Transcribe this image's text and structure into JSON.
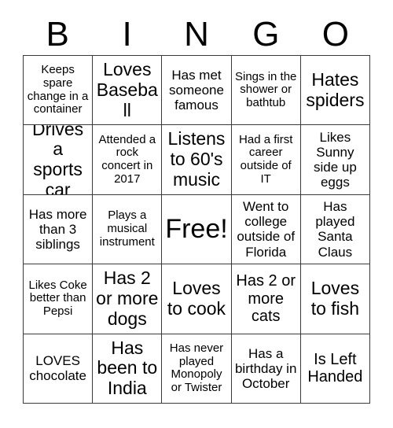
{
  "card": {
    "header_letters": [
      "B",
      "I",
      "N",
      "G",
      "O"
    ],
    "grid": {
      "columns": 5,
      "rows": 5,
      "line_color": "#3a3a3a",
      "background": "#ffffff",
      "text_color": "#000000"
    },
    "cells": [
      {
        "text": "Keeps spare change in a container",
        "size": "fs-s",
        "free": false
      },
      {
        "text": "Loves Baseball",
        "size": "fs-xl",
        "free": false
      },
      {
        "text": "Has met someone famous",
        "size": "fs-m",
        "free": false
      },
      {
        "text": "Sings in the shower or bathtub",
        "size": "fs-s",
        "free": false
      },
      {
        "text": "Hates spiders",
        "size": "fs-xl",
        "free": false
      },
      {
        "text": "Drives a sports car",
        "size": "fs-xl",
        "free": false
      },
      {
        "text": "Attended a rock concert in 2017",
        "size": "fs-s",
        "free": false
      },
      {
        "text": "Listens to 60's music",
        "size": "fs-xl",
        "free": false
      },
      {
        "text": "Had a first career outside of IT",
        "size": "fs-s",
        "free": false
      },
      {
        "text": "Likes Sunny side up eggs",
        "size": "fs-m",
        "free": false
      },
      {
        "text": "Has more than 3 siblings",
        "size": "fs-m",
        "free": false
      },
      {
        "text": "Plays a musical instrument",
        "size": "fs-s",
        "free": false
      },
      {
        "text": "Free!",
        "size": "fs-free",
        "free": true
      },
      {
        "text": "Went to college outside of Florida",
        "size": "fs-m",
        "free": false
      },
      {
        "text": "Has played Santa Claus",
        "size": "fs-m",
        "free": false
      },
      {
        "text": "Likes Coke better than Pepsi",
        "size": "fs-s",
        "free": false
      },
      {
        "text": "Has 2 or more dogs",
        "size": "fs-xl",
        "free": false
      },
      {
        "text": "Loves to cook",
        "size": "fs-xl",
        "free": false
      },
      {
        "text": "Has 2 or more cats",
        "size": "fs-l",
        "free": false
      },
      {
        "text": "Loves to fish",
        "size": "fs-xl",
        "free": false
      },
      {
        "text": "LOVES chocolate",
        "size": "fs-m",
        "free": false
      },
      {
        "text": "Has been to India",
        "size": "fs-xl",
        "free": false
      },
      {
        "text": "Has never played Monopoly or Twister",
        "size": "fs-s",
        "free": false
      },
      {
        "text": "Has a birthday in October",
        "size": "fs-m",
        "free": false
      },
      {
        "text": "Is Left Handed",
        "size": "fs-l",
        "free": false
      }
    ]
  }
}
